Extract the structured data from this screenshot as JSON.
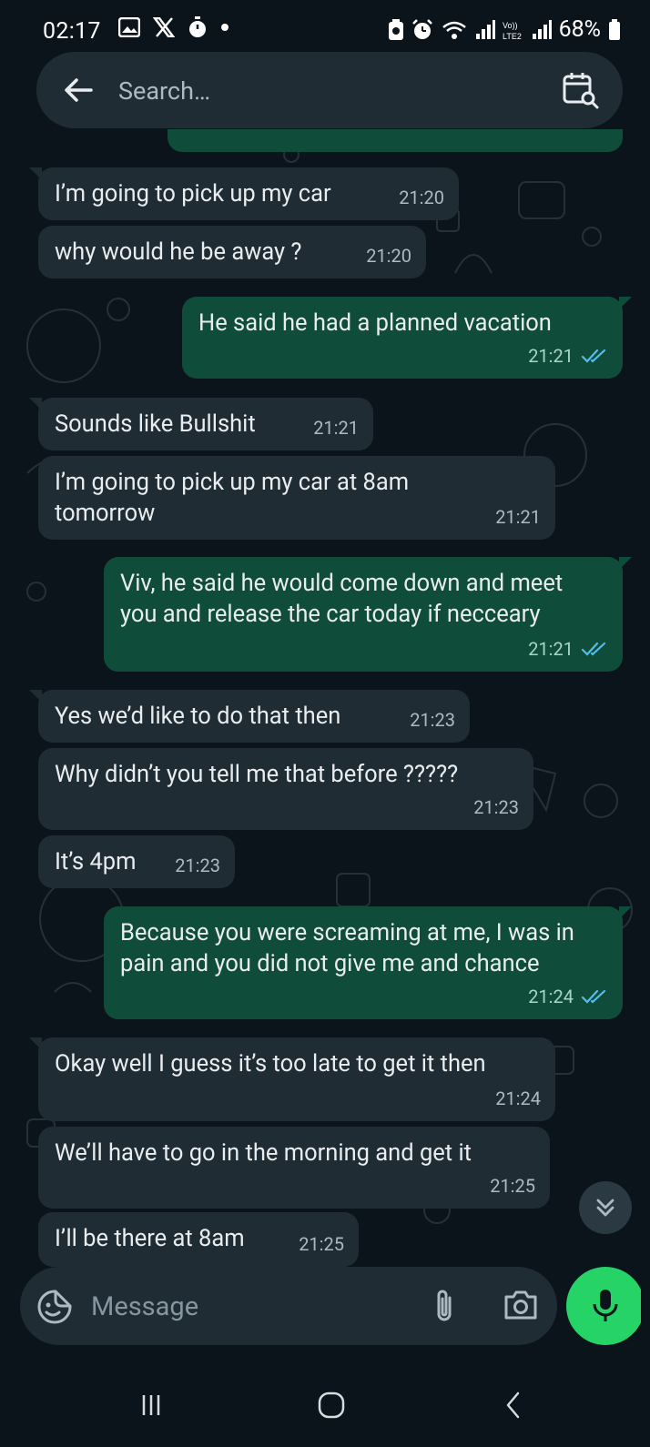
{
  "status_bar": {
    "time": "02:17",
    "battery": "68%",
    "left_icons": [
      "gallery-icon",
      "x-logo-icon",
      "timer-icon",
      "dot-icon"
    ],
    "right_icons": [
      "battery-saver-icon",
      "alarm-icon",
      "wifi-icon",
      "signal-icon",
      "volte-icon",
      "signal-2-icon",
      "battery-icon"
    ]
  },
  "search": {
    "placeholder": "Search…"
  },
  "messages": [
    {
      "dir": "in",
      "text": "I’m going to pick up my car",
      "time": "21:20"
    },
    {
      "dir": "in",
      "text": "why would he be away ?",
      "time": "21:20"
    },
    {
      "dir": "out",
      "text": "He said he had a planned vacation",
      "time": "21:21",
      "read": true
    },
    {
      "dir": "in",
      "text": "Sounds like Bullshit",
      "time": "21:21"
    },
    {
      "dir": "in",
      "text": "I’m going to pick up my car at 8am tomorrow",
      "time": "21:21"
    },
    {
      "dir": "out",
      "text": "Viv, he said he would come down and meet you and release the car today if necceary",
      "time": "21:21",
      "read": true
    },
    {
      "dir": "in",
      "text": "Yes we’d like to do that then",
      "time": "21:23"
    },
    {
      "dir": "in",
      "text": "Why didn’t you tell me that before ?????",
      "time": "21:23"
    },
    {
      "dir": "in",
      "text": "It’s 4pm",
      "time": "21:23"
    },
    {
      "dir": "out",
      "text": "Because you were screaming at me, I was in pain and you did not give me and chance",
      "time": "21:24",
      "read": true
    },
    {
      "dir": "in",
      "text": "Okay well I guess it’s too late to get it then",
      "time": "21:24"
    },
    {
      "dir": "in",
      "text": "We’ll have to go in the morning and get it",
      "time": "21:25"
    },
    {
      "dir": "in",
      "text": "I’ll be there at 8am",
      "time": "21:25"
    }
  ],
  "composer": {
    "placeholder": "Message"
  },
  "colors": {
    "background": "#0b141a",
    "incoming_bubble": "#202c33",
    "outgoing_bubble": "#104c3a",
    "read_ticks": "#53bdeb",
    "mic_button": "#25d366"
  }
}
